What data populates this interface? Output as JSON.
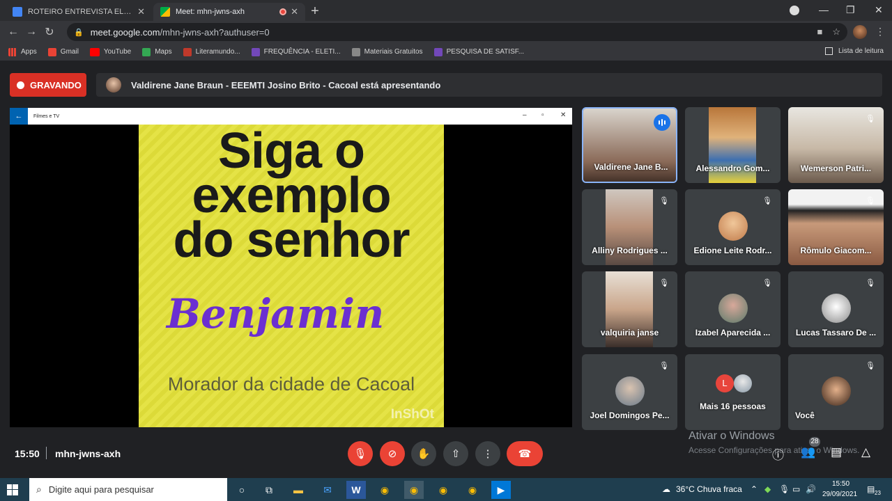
{
  "browser": {
    "tabs": [
      {
        "title": "ROTEIRO ENTREVISTA ELETIVA - Doc",
        "icon": "google-docs-icon"
      },
      {
        "title": "Meet: mhn-jwns-axh",
        "icon": "google-meet-icon"
      }
    ],
    "url_host": "meet.google.com",
    "url_path": "/mhn-jwns-axh?authuser=0",
    "bookmarks": [
      "Apps",
      "Gmail",
      "YouTube",
      "Maps",
      "Literamundo...",
      "FREQUÊNCIA - ELETI...",
      "Materiais Gratuitos",
      "PESQUISA DE SATISF..."
    ],
    "reading_list": "Lista de leitura"
  },
  "meet": {
    "recording_label": "GRAVANDO",
    "presenting_text": "Valdirene Jane Braun - EEEMTI Josino Brito - Cacoal está apresentando",
    "presentation": {
      "app_title": "Filmes e TV",
      "line1": "Siga o",
      "line2": "exemplo",
      "line3": "do senhor",
      "name": "Benjamin",
      "subtitle": "Morador da cidade de Cacoal",
      "watermark": "InShOt"
    },
    "participants": [
      "Valdirene Jane B...",
      "Alessandro Gom...",
      "Wemerson Patri...",
      "Alliny Rodrigues ...",
      "Edione Leite Rodr...",
      "Rômulo Giacom...",
      "valquiria janse",
      "Izabel Aparecida ...",
      "Lucas Tassaro De ...",
      "Joel Domingos Pe...",
      "Mais 16 pessoas",
      "Você"
    ],
    "more_initial": "L",
    "time": "15:50",
    "meeting_code": "mhn-jwns-axh",
    "people_count": "28",
    "activate_title": "Ativar o Windows",
    "activate_sub": "Acesse Configurações para ativar o Windows."
  },
  "taskbar": {
    "search_placeholder": "Digite aqui para pesquisar",
    "weather": "36°C  Chuva fraca",
    "time": "15:50",
    "date": "29/09/2021",
    "notifications": "23"
  }
}
